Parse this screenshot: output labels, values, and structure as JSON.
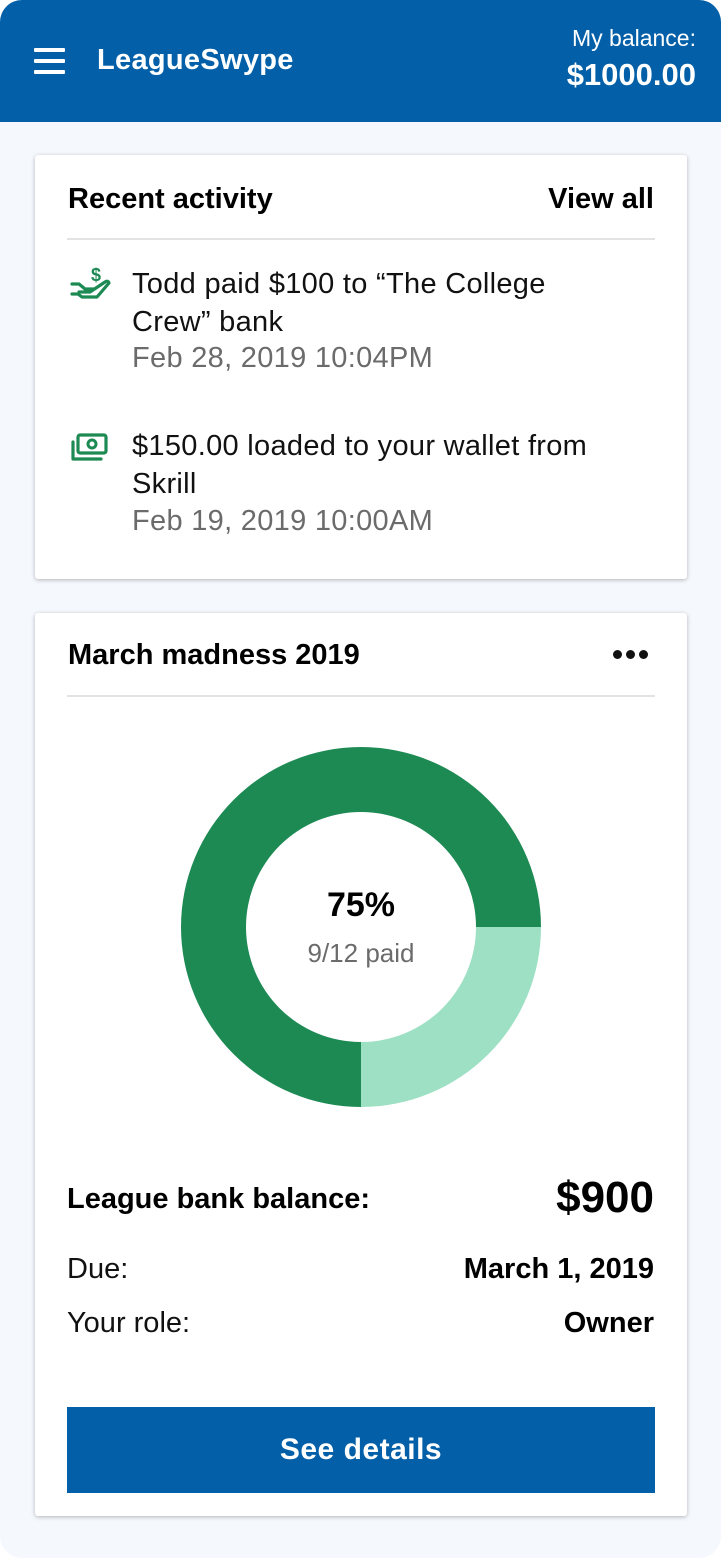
{
  "header": {
    "app_title": "LeagueSwype",
    "balance_label": "My balance:",
    "balance_value": "$1000.00"
  },
  "recent_activity": {
    "title": "Recent activity",
    "view_all_label": "View all",
    "items": [
      {
        "icon": "hand-dollar-icon",
        "text": "Todd paid $100 to “The College Crew” bank",
        "date": "Feb 28, 2019 10:04PM"
      },
      {
        "icon": "money-stack-icon",
        "text": "$150.00 loaded to your wallet from Skrill",
        "date": "Feb 19, 2019 10:00AM"
      }
    ]
  },
  "league_card": {
    "title": "March madness 2019",
    "progress_percent": "75%",
    "paid_text": "9/12 paid",
    "paid_fraction": 0.75,
    "bank_balance_label": "League bank balance:",
    "bank_balance_value": "$900",
    "due_label": "Due:",
    "due_value": "March 1, 2019",
    "role_label": "Your role:",
    "role_value": "Owner",
    "details_button_label": "See details"
  },
  "colors": {
    "brand_blue": "#0360a8",
    "paid_green": "#1d8a54",
    "unpaid_green": "#9de0c4"
  }
}
